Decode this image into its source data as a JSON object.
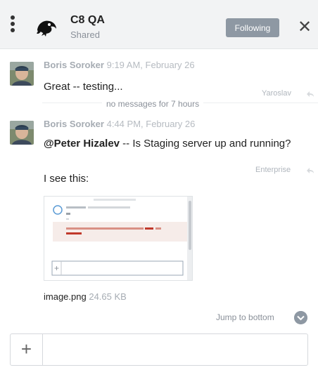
{
  "channel": {
    "title": "C8 QA",
    "subtitle": "Shared",
    "follow_label": "Following",
    "close_glyph": "✕"
  },
  "messages": [
    {
      "author": "Boris Soroker",
      "time": "9:19 AM, February 26",
      "text": "Great -- testing...",
      "side_tag": "Yaroslav"
    },
    {
      "author": "Boris Soroker",
      "time": "4:44 PM, February 26",
      "mention": "@Peter Hizalev",
      "text": " -- Is Staging server up and running?",
      "text2": "I see this:",
      "side_tag": "Enterprise"
    }
  ],
  "divider": {
    "text": "no messages for 7 hours"
  },
  "attachment": {
    "file_name": "image.png",
    "file_size": "24.65 KB"
  },
  "jump": {
    "label": "Jump to bottom"
  },
  "composer": {
    "add_glyph": "+",
    "placeholder": ""
  },
  "colors": {
    "accent": "#8e98a3",
    "header_bg": "#f2f3f4",
    "error_bg": "#f6ece9"
  },
  "icons": [
    "kebab-menu-icon",
    "channel-logo-icon",
    "close-icon",
    "reply-icon",
    "chevron-down-icon",
    "plus-icon"
  ]
}
